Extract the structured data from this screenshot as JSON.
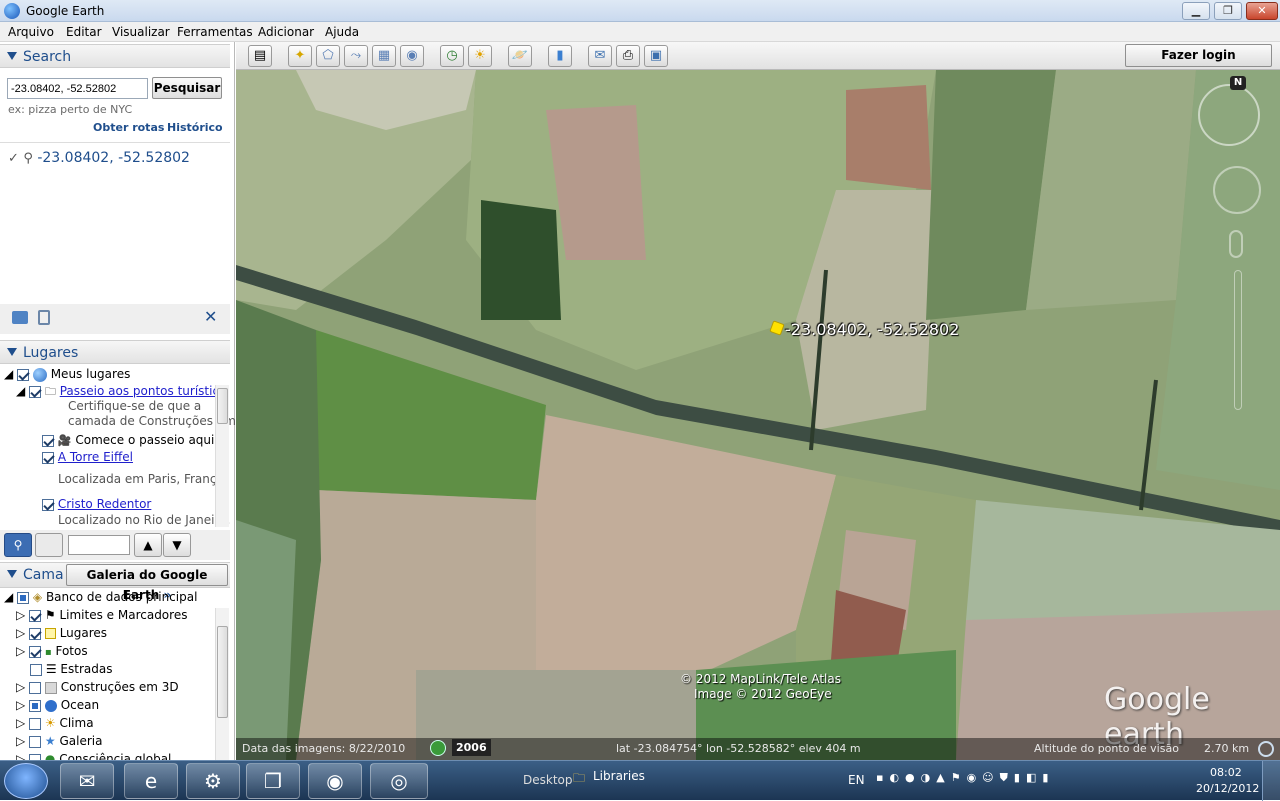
{
  "window": {
    "title": "Google Earth",
    "min_label": "▁",
    "max_label": "❐",
    "close_label": "✕"
  },
  "menu": [
    "Arquivo",
    "Editar",
    "Visualizar",
    "Ferramentas",
    "Adicionar",
    "Ajuda"
  ],
  "search": {
    "header": "Search",
    "value": "-23.08402, -52.52802",
    "button": "Pesquisar",
    "hint": "ex: pizza perto de NYC",
    "directions_link": "Obter rotas",
    "history_link": "Histórico",
    "result": "-23.08402, -52.52802"
  },
  "places": {
    "header": "Lugares",
    "items": [
      {
        "label": "Meus lugares"
      },
      {
        "label": "Passeio aos pontos turístico",
        "desc1": "Certifique-se de que a",
        "desc2": "camada de Construções em"
      },
      {
        "label": "Comece o passeio aqui"
      },
      {
        "label": "A Torre Eiffel",
        "desc": "Localizada em Paris, França"
      },
      {
        "label": "Cristo Redentor",
        "desc": "Localizado no Rio de Janeiro,"
      }
    ]
  },
  "layers": {
    "header": "Cama",
    "gallery_button": "Galeria do Google Earth",
    "items": [
      {
        "label": "Banco de dados principal"
      },
      {
        "label": "Limites e Marcadores"
      },
      {
        "label": "Lugares"
      },
      {
        "label": "Fotos"
      },
      {
        "label": "Estradas"
      },
      {
        "label": "Construções em 3D"
      },
      {
        "label": "Ocean"
      },
      {
        "label": "Clima"
      },
      {
        "label": "Galeria"
      },
      {
        "label": "Consciência global"
      }
    ]
  },
  "toolbar": {
    "login": "Fazer login"
  },
  "map": {
    "placemark_label": "-23.08402, -52.52802",
    "credit1": "© 2012 MapLink/Tele Atlas",
    "credit2": "Image © 2012 GeoEye",
    "logo": "Google earth",
    "compass_n": "N"
  },
  "status": {
    "imagery_date": "Data das imagens: 8/22/2010",
    "year": "2006",
    "coords": "lat  -23.084754°  lon  -52.528582°  elev   404 m",
    "eye_alt": "Altitude do ponto de visão",
    "eye_alt_value": "2.70 km"
  },
  "taskbar": {
    "desktop": "Desktop",
    "libraries": "Libraries",
    "lang": "EN",
    "time": "08:02",
    "date": "20/12/2012"
  }
}
